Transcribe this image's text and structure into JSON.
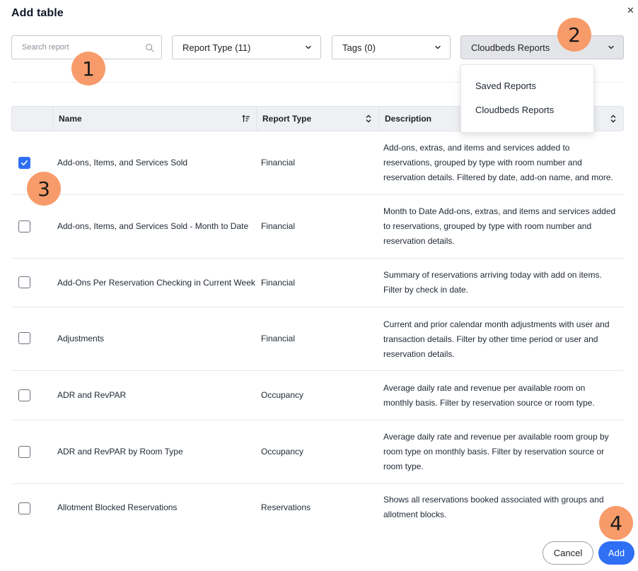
{
  "dialog": {
    "title": "Add table"
  },
  "filters": {
    "search_placeholder": "Search report",
    "report_type": "Report Type (11)",
    "tags": "Tags (0)",
    "source": "Cloudbeds Reports",
    "source_options": [
      "Saved Reports",
      "Cloudbeds Reports"
    ]
  },
  "table": {
    "columns": [
      "Name",
      "Report Type",
      "Description"
    ],
    "rows": [
      {
        "checked": true,
        "name": "Add-ons, Items, and Services Sold",
        "type": "Financial",
        "description": "Add-ons, extras, and items and services added to reservations, grouped by type with room number and reservation details. Filtered by date, add-on name, and more."
      },
      {
        "checked": false,
        "name": "Add-ons, Items, and Services Sold - Month to Date",
        "type": "Financial",
        "description": "Month to Date Add-ons, extras, and items and services added to reservations, grouped by type with room number and reservation details."
      },
      {
        "checked": false,
        "name": "Add-Ons Per Reservation Checking in Current Week",
        "type": "Financial",
        "description": "Summary of reservations arriving today with add on items. Filter by check in date."
      },
      {
        "checked": false,
        "name": "Adjustments",
        "type": "Financial",
        "description": "Current and prior calendar month adjustments with user and transaction details. Filter by other time period or user and reservation details."
      },
      {
        "checked": false,
        "name": "ADR and RevPAR",
        "type": "Occupancy",
        "description": "Average daily rate and revenue per available room on monthly basis. Filter by reservation source or room type."
      },
      {
        "checked": false,
        "name": "ADR and RevPAR by Room Type",
        "type": "Occupancy",
        "description": "Average daily rate and revenue per available room group by room type on monthly basis. Filter by reservation source or room type."
      },
      {
        "checked": false,
        "name": "Allotment Blocked Reservations",
        "type": "Reservations",
        "description": "Shows all reservations booked associated with groups and allotment blocks."
      }
    ]
  },
  "actions": {
    "cancel": "Cancel",
    "add": "Add"
  },
  "markers": [
    "1",
    "2",
    "3",
    "4"
  ],
  "colors": {
    "accent": "#2f6ff4",
    "marker": "#f79b6a"
  }
}
